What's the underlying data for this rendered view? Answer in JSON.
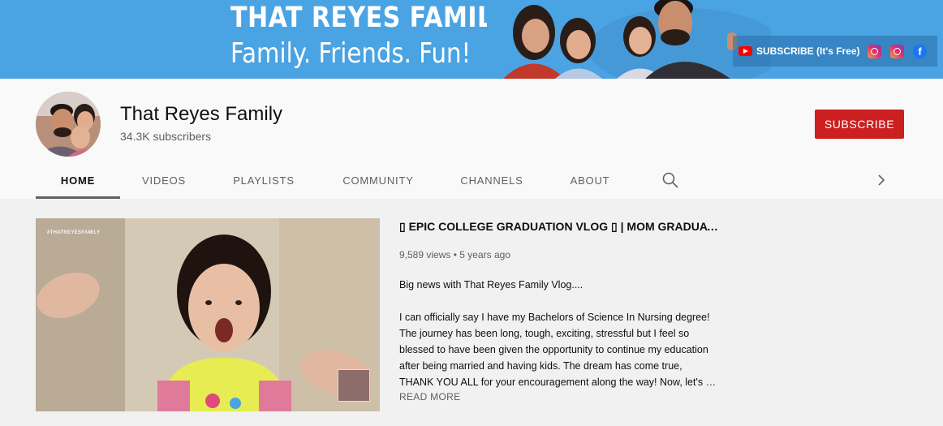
{
  "banner": {
    "title": "THAT REYES FAMILY",
    "tagline": "Family. Friends. Fun!",
    "subscribe_link": "SUBSCRIBE (It's Free)",
    "social_icons": [
      "youtube-icon",
      "instagram-icon",
      "instagram-icon",
      "facebook-icon"
    ],
    "facebook_glyph": "f",
    "color": "#4aa3e3"
  },
  "channel": {
    "name": "That Reyes Family",
    "subscribers": "34.3K subscribers",
    "subscribe_label": "SUBSCRIBE",
    "subscribe_color": "#cc1f1f"
  },
  "tabs": [
    {
      "label": "HOME",
      "active": true
    },
    {
      "label": "VIDEOS",
      "active": false
    },
    {
      "label": "PLAYLISTS",
      "active": false
    },
    {
      "label": "COMMUNITY",
      "active": false
    },
    {
      "label": "CHANNELS",
      "active": false
    },
    {
      "label": "ABOUT",
      "active": false
    }
  ],
  "tab_icons": [
    "search-icon",
    "chevron-right-icon"
  ],
  "featured_video": {
    "thumbnail_watermark": "#THATREYESFAMILY",
    "title": "▯ EPIC COLLEGE GRADUATION VLOG ▯ | MOM GRADUATES NURSING SCHOOL",
    "views": "9,589 views",
    "separator": "•",
    "age": "5 years ago",
    "description_intro": "Big news with That Reyes Family Vlog....",
    "description_lines": [
      "I can officially say I have my Bachelors of Science In Nursing degree!",
      "The journey has been long, tough, exciting, stressful but I feel so",
      "blessed to have been given the opportunity to continue my education",
      "after being married and having kids. The dream has come true,",
      "THANK YOU ALL for your encouragement along the way! Now, let's …"
    ],
    "read_more": "READ MORE"
  }
}
